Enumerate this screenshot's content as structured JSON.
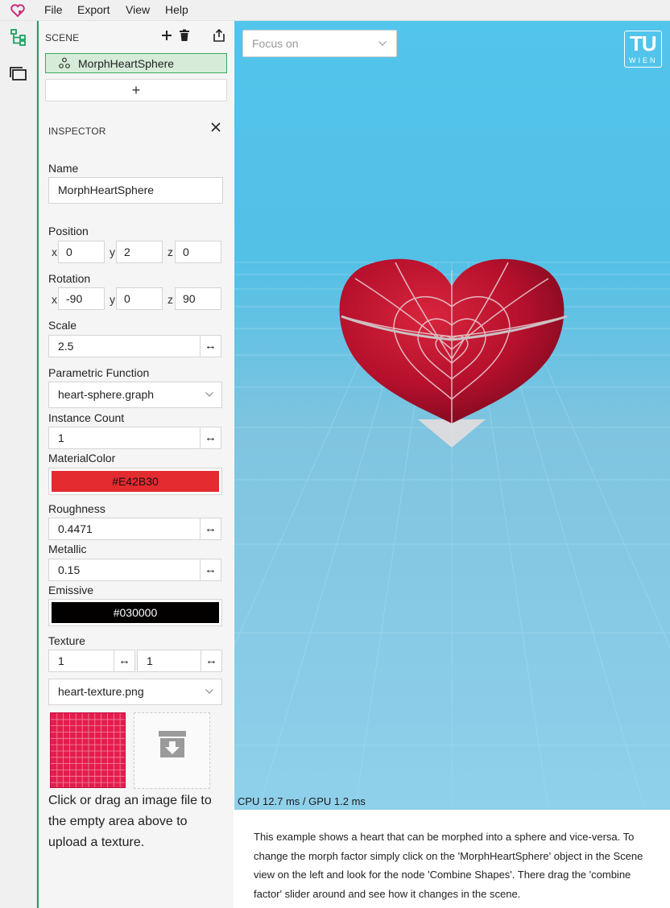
{
  "menu": {
    "items": [
      "File",
      "Export",
      "View",
      "Help"
    ]
  },
  "activity_bar": {
    "icons": [
      "scene-tree-icon",
      "files-icon"
    ]
  },
  "scene": {
    "title": "SCENE",
    "selected_item": "MorphHeartSphere",
    "add_label": "+"
  },
  "inspector": {
    "title": "INSPECTOR",
    "name": {
      "label": "Name",
      "value": "MorphHeartSphere"
    },
    "position": {
      "label": "Position",
      "x": "0",
      "y": "2",
      "z": "0"
    },
    "rotation": {
      "label": "Rotation",
      "x": "-90",
      "y": "0",
      "z": "90"
    },
    "axis_labels": {
      "x": "x",
      "y": "y",
      "z": "z"
    },
    "scale": {
      "label": "Scale",
      "value": "2.5"
    },
    "parametric_function": {
      "label": "Parametric Function",
      "value": "heart-sphere.graph"
    },
    "instance_count": {
      "label": "Instance Count",
      "value": "1"
    },
    "material_color": {
      "label": "MaterialColor",
      "value": "#E42B30",
      "color": "#E42B30"
    },
    "roughness": {
      "label": "Roughness",
      "value": "0.4471"
    },
    "metallic": {
      "label": "Metallic",
      "value": "0.15"
    },
    "emissive": {
      "label": "Emissive",
      "value": "#030000",
      "color": "#030000"
    },
    "texture": {
      "label": "Texture",
      "u": "1",
      "v": "1",
      "file": "heart-texture.png"
    },
    "drag_glyph": "↔",
    "help_text": "Click or drag an image file to the empty area above to upload a texture."
  },
  "viewport": {
    "focus_placeholder": "Focus on",
    "logo": {
      "top": "TU",
      "bottom": "WIEN"
    },
    "perf_text": "CPU 12.7 ms / GPU 1.2 ms"
  },
  "description": "This example shows a heart that can be morphed into a sphere and vice-versa. To change the morph factor simply click on the 'MorphHeartSphere' object in the Scene view on the left and look for the node 'Combine Shapes'. There drag the 'combine factor' slider around and see how it changes in the scene."
}
